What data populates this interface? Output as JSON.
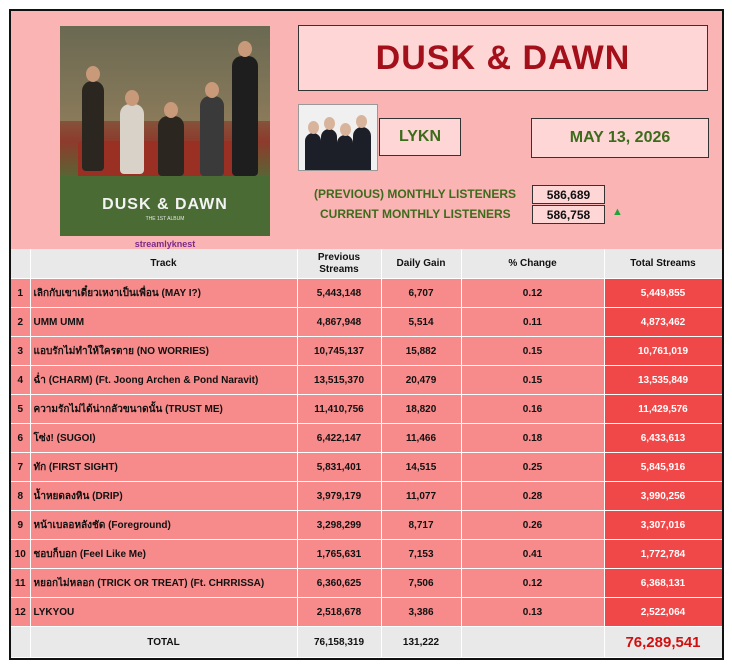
{
  "header": {
    "title": "DUSK & DAWN",
    "artist": "LYKN",
    "date": "MAY 13, 2026",
    "watermark": "streamlyknest",
    "album_cover": {
      "title": "DUSK & DAWN",
      "subtitle": "THE 1ST ALBUM"
    }
  },
  "listeners": {
    "previous_label": "(PREVIOUS) MONTHLY LISTENERS",
    "previous_value": "586,689",
    "current_label": "CURRENT MONTHLY LISTENERS",
    "current_value": "586,758",
    "trend": "up",
    "trend_color": "#1fa33a"
  },
  "table": {
    "columns": [
      "",
      "Track",
      "Previous Streams",
      "Daily Gain",
      "% Change",
      "Total Streams"
    ],
    "rows": [
      {
        "rank": "1",
        "track": "เลิกกับเขาเดี๋ยวเหงาเป็นเพื่อน (MAY I?)",
        "previous": "5,443,148",
        "gain": "6,707",
        "change": "0.12",
        "total": "5,449,855"
      },
      {
        "rank": "2",
        "track": "UMM UMM",
        "previous": "4,867,948",
        "gain": "5,514",
        "change": "0.11",
        "total": "4,873,462"
      },
      {
        "rank": "3",
        "track": "แอบรักไม่ทำให้ใครตาย (NO WORRIES)",
        "previous": "10,745,137",
        "gain": "15,882",
        "change": "0.15",
        "total": "10,761,019"
      },
      {
        "rank": "4",
        "track": "ฉ่ำ (CHARM) (Ft. Joong Archen & Pond Naravit)",
        "previous": "13,515,370",
        "gain": "20,479",
        "change": "0.15",
        "total": "13,535,849"
      },
      {
        "rank": "5",
        "track": "ความรักไม่ได้น่ากลัวขนาดนั้น (TRUST ME)",
        "previous": "11,410,756",
        "gain": "18,820",
        "change": "0.16",
        "total": "11,429,576"
      },
      {
        "rank": "6",
        "track": "โซ่ง! (SUGOI)",
        "previous": "6,422,147",
        "gain": "11,466",
        "change": "0.18",
        "total": "6,433,613"
      },
      {
        "rank": "7",
        "track": "ทัก (FIRST SIGHT)",
        "previous": "5,831,401",
        "gain": "14,515",
        "change": "0.25",
        "total": "5,845,916"
      },
      {
        "rank": "8",
        "track": "น้ำหยดลงหิน (DRIP)",
        "previous": "3,979,179",
        "gain": "11,077",
        "change": "0.28",
        "total": "3,990,256"
      },
      {
        "rank": "9",
        "track": "หน้าเบลอหลังชัด (Foreground)",
        "previous": "3,298,299",
        "gain": "8,717",
        "change": "0.26",
        "total": "3,307,016"
      },
      {
        "rank": "10",
        "track": "ชอบก็บอก (Feel Like Me)",
        "previous": "1,765,631",
        "gain": "7,153",
        "change": "0.41",
        "total": "1,772,784"
      },
      {
        "rank": "11",
        "track": "หยอกไม่หลอก (TRICK OR TREAT) (Ft. CHRRISSA)",
        "previous": "6,360,625",
        "gain": "7,506",
        "change": "0.12",
        "total": "6,368,131"
      },
      {
        "rank": "12",
        "track": "LYKYOU",
        "previous": "2,518,678",
        "gain": "3,386",
        "change": "0.13",
        "total": "2,522,064"
      }
    ],
    "total": {
      "label": "TOTAL",
      "previous": "76,158,319",
      "gain": "131,222",
      "total": "76,289,541"
    }
  }
}
